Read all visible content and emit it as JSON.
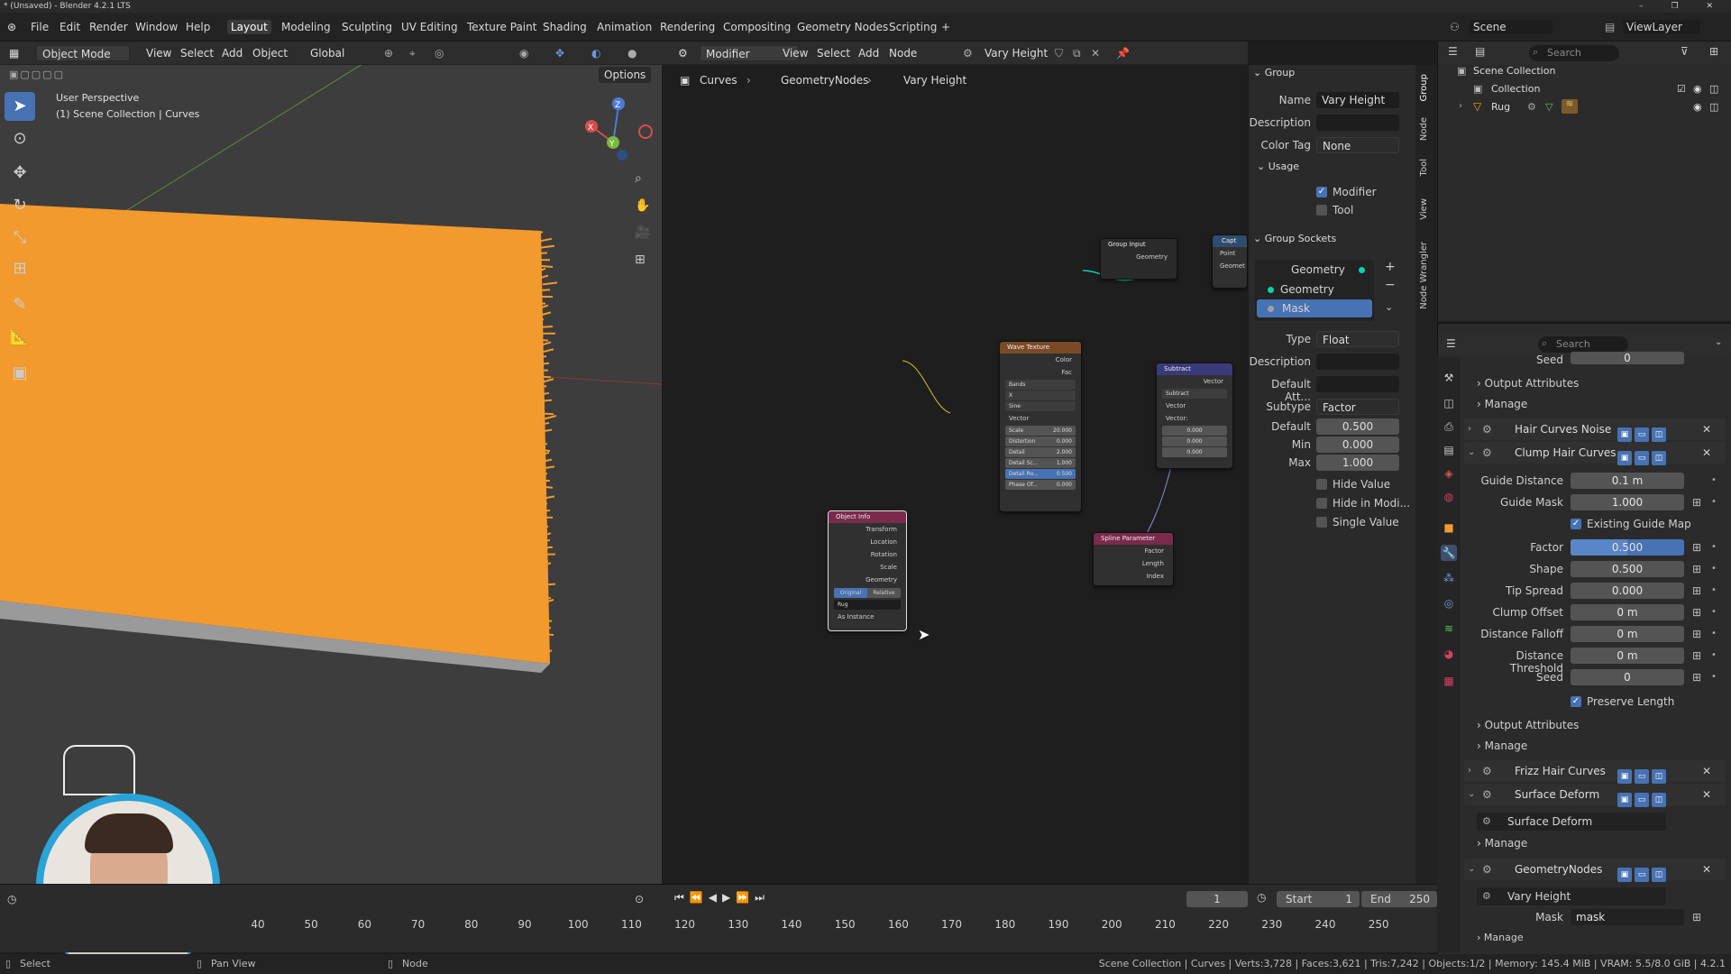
{
  "titlebar": {
    "title": "* (Unsaved) - Blender 4.2.1 LTS",
    "controls": "–  ❐  ✕"
  },
  "menu": {
    "file": [
      "File",
      "Edit",
      "Render",
      "Window",
      "Help"
    ],
    "workspaces": [
      "Layout",
      "Modeling",
      "Sculpting",
      "UV Editing",
      "Texture Paint",
      "Shading",
      "Animation",
      "Rendering",
      "Compositing",
      "Geometry Nodes",
      "Scripting"
    ],
    "add_workspace": "+",
    "scene": "Scene",
    "viewlayer": "ViewLayer"
  },
  "viewport": {
    "mode": "Object Mode",
    "menus": [
      "View",
      "Select",
      "Add",
      "Object"
    ],
    "transform": "Global",
    "options": "Options",
    "overlay_title": "User Perspective",
    "overlay_sub": "(1) Scene Collection | Curves",
    "gizmo": {
      "z": "Z",
      "x": "X",
      "y": "Y"
    },
    "colors": {
      "fur": "#f29a2e",
      "bg": "#3d3d3d"
    }
  },
  "node_editor": {
    "type": "Modifier",
    "menus": [
      "View",
      "Select",
      "Add",
      "Node"
    ],
    "tree_name": "Vary Height",
    "breadcrumb": [
      "Curves",
      "GeometryNodes",
      "Vary Height"
    ],
    "nodes": {
      "group_input": {
        "title": "Group Input",
        "out": "Geometry"
      },
      "capture": {
        "title": "Capt",
        "rows": [
          "Point",
          "Geomet"
        ]
      },
      "wave": {
        "title": "Wave Texture",
        "outputs": [
          "Color",
          "Fac"
        ],
        "dropdowns": [
          "Bands",
          "X",
          "Sine"
        ],
        "vector": "Vector",
        "fields": [
          {
            "k": "Scale",
            "v": "20.000"
          },
          {
            "k": "Distortion",
            "v": "0.000"
          },
          {
            "k": "Detail",
            "v": "2.000"
          },
          {
            "k": "Detail Sc...",
            "v": "1.000"
          },
          {
            "k": "Detail Ro...",
            "v": "0.500"
          },
          {
            "k": "Phase Of...",
            "v": "0.000"
          }
        ]
      },
      "subtract": {
        "title": "Subtract",
        "out": "Vector",
        "op": "Subtract",
        "rows": [
          "Vector",
          "Vector:"
        ],
        "vals": [
          "0.000",
          "0.000",
          "0.000"
        ]
      },
      "spline": {
        "title": "Spline Parameter",
        "outputs": [
          "Factor",
          "Length",
          "Index"
        ]
      },
      "object_info": {
        "title": "Object Info",
        "outputs": [
          "Transform",
          "Location",
          "Rotation",
          "Scale",
          "Geometry"
        ],
        "toggle": [
          "Original",
          "Relative"
        ],
        "object": "Rug",
        "as_instance": "As Instance"
      }
    }
  },
  "npanel": {
    "group_header": "Group",
    "name_label": "Name",
    "name": "Vary Height",
    "desc_label": "Description",
    "color_tag_label": "Color Tag",
    "color_tag": "None",
    "usage_header": "Usage",
    "modifier": "Modifier",
    "tool": "Tool",
    "sockets_header": "Group Sockets",
    "sockets": [
      "Geometry",
      "Geometry",
      "Mask"
    ],
    "type_label": "Type",
    "type": "Float",
    "description_label": "Description",
    "default_attr_label": "Default Att...",
    "subtype_label": "Subtype",
    "subtype": "Factor",
    "default_label": "Default",
    "default": "0.500",
    "min_label": "Min",
    "min": "0.000",
    "max_label": "Max",
    "max": "1.000",
    "hide_value": "Hide Value",
    "hide_in_mod": "Hide in Modi...",
    "single_value": "Single Value",
    "tabs": [
      "Group",
      "Node",
      "Tool",
      "View",
      "Node Wrangler"
    ]
  },
  "outliner": {
    "search": "Search",
    "root": "Scene Collection",
    "collection": "Collection",
    "rug": "Rug"
  },
  "properties": {
    "search": "Search",
    "seed_top_label": "Seed",
    "seed_top": "0",
    "output_attributes": "Output Attributes",
    "manage": "Manage",
    "mods": {
      "hair_noise": "Hair Curves Noise",
      "clump": "Clump Hair Curves",
      "frizz": "Frizz Hair Curves",
      "surface": "Surface Deform",
      "geonodes": "GeometryNodes"
    },
    "clump_fields": [
      {
        "label": "Guide Distance",
        "value": "0.1 m"
      },
      {
        "label": "Guide Mask",
        "value": "1.000"
      },
      {
        "label": "Factor",
        "value": "0.500"
      },
      {
        "label": "Shape",
        "value": "0.500"
      },
      {
        "label": "Tip Spread",
        "value": "0.000"
      },
      {
        "label": "Clump Offset",
        "value": "0 m"
      },
      {
        "label": "Distance Falloff",
        "value": "0 m"
      },
      {
        "label": "Distance Threshold",
        "value": "0 m"
      },
      {
        "label": "Seed",
        "value": "0"
      }
    ],
    "existing_guide_map": "Existing Guide Map",
    "preserve_length": "Preserve Length",
    "surface_deform_node": "Surface Deform",
    "vary_height_node": "Vary Height",
    "mask_label": "Mask",
    "mask_value": "mask",
    "factor_fill": 0.5
  },
  "timeline": {
    "frame": "1",
    "start_label": "Start",
    "start": "1",
    "end_label": "End",
    "end": "250",
    "ticks": [
      "40",
      "50",
      "60",
      "70",
      "80",
      "90",
      "100",
      "110",
      "120",
      "130",
      "140",
      "150",
      "160",
      "170",
      "180",
      "190",
      "200",
      "210",
      "220",
      "230",
      "240",
      "250"
    ]
  },
  "status": {
    "left": [
      "Select",
      "Pan View",
      "Node"
    ],
    "right": "Scene Collection | Curves | Verts:3,728 | Faces:3,621 | Tris:7,242 | Objects:1/2 | Memory: 145.4 MiB | VRAM: 5.5/8.0 GiB | 4.2.1"
  }
}
